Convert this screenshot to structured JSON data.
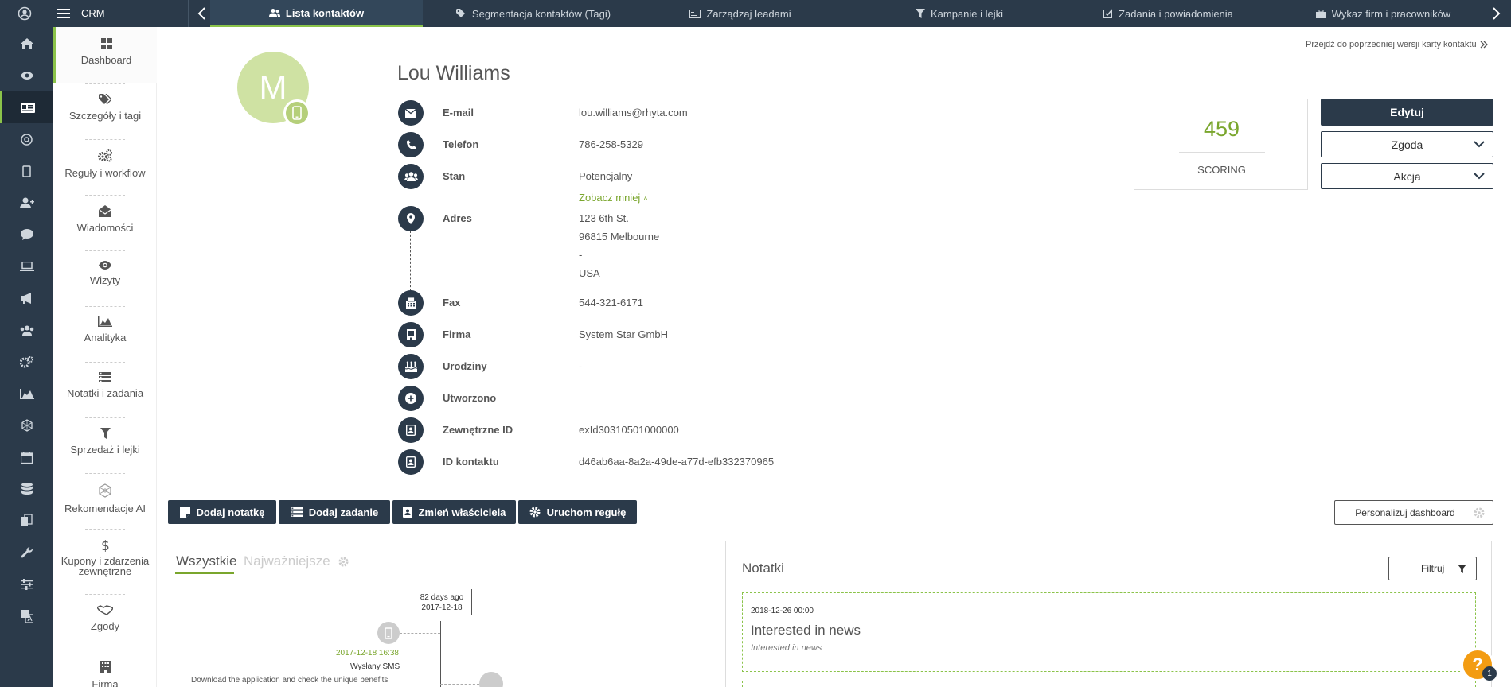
{
  "app": {
    "title": "CRM"
  },
  "nav_tabs": [
    {
      "label": "Lista kontaktów",
      "icon": "users-icon"
    },
    {
      "label": "Segmentacja kontaktów (Tagi)",
      "icon": "tags-icon"
    },
    {
      "label": "Zarządzaj leadami",
      "icon": "id-card-icon"
    },
    {
      "label": "Kampanie i lejki",
      "icon": "funnel-icon"
    },
    {
      "label": "Zadania i powiadomienia",
      "icon": "checkbox-icon"
    },
    {
      "label": "Wykaz firm i pracowników",
      "icon": "briefcase-icon"
    }
  ],
  "subnav": [
    {
      "label": "Dashboard",
      "icon": "dashboard-icon"
    },
    {
      "label": "Szczegóły i tagi",
      "icon": "tags-icon"
    },
    {
      "label": "Reguły i workflow",
      "icon": "cogs-icon"
    },
    {
      "label": "Wiadomości",
      "icon": "envelope-open-icon"
    },
    {
      "label": "Wizyty",
      "icon": "eye-icon"
    },
    {
      "label": "Analityka",
      "icon": "area-chart-icon"
    },
    {
      "label": "Notatki i zadania",
      "icon": "tasks-icon"
    },
    {
      "label": "Sprzedaż i lejki",
      "icon": "funnel-icon"
    },
    {
      "label": "Rekomendacje AI",
      "icon": "ai-icon"
    },
    {
      "label": "Kupony i zdarzenia",
      "label2": "zewnętrzne",
      "icon": "dollar-icon"
    },
    {
      "label": "Zgody",
      "icon": "handshake-icon"
    },
    {
      "label": "Firma",
      "icon": "building-icon"
    }
  ],
  "prev_version_link": "Przejdź do poprzedniej wersji karty kontaktu",
  "contact": {
    "avatar_letter": "M",
    "name": "Lou Williams",
    "fields": [
      {
        "label": "E-mail",
        "value": "lou.williams@rhyta.com",
        "icon": "envelope-icon"
      },
      {
        "label": "Telefon",
        "value": "786-258-5329",
        "icon": "phone-icon"
      },
      {
        "label": "Stan",
        "value": "Potencjalny",
        "icon": "group-icon"
      },
      {
        "label": "Adres",
        "icon": "map-marker-icon",
        "lines": [
          "123 6th St.",
          "96815 Melbourne",
          "-",
          "USA"
        ]
      },
      {
        "label": "Fax",
        "value": "544-321-6171",
        "icon": "fax-icon"
      },
      {
        "label": "Firma",
        "value": "System Star GmbH",
        "icon": "building-icon"
      },
      {
        "label": "Urodziny",
        "value": "-",
        "icon": "birthday-cake-icon"
      },
      {
        "label": "Utworzono",
        "value": "",
        "icon": "plus-circle-icon"
      },
      {
        "label": "Zewnętrzne ID",
        "value": "exId30310501000000",
        "icon": "contact-card-icon"
      },
      {
        "label": "ID kontaktu",
        "value": "d46ab6aa-8a2a-49de-a77d-efb332370965",
        "icon": "contact-card-icon"
      }
    ],
    "see_less": "Zobacz mniej"
  },
  "scoring": {
    "value": "459",
    "label": "SCORING"
  },
  "actions": {
    "edit": "Edytuj",
    "consent": "Zgoda",
    "action": "Akcja"
  },
  "toolbar": {
    "add_note": "Dodaj notatkę",
    "add_task": "Dodaj zadanie",
    "change_owner": "Zmień właściciela",
    "run_rule": "Uruchom regułę",
    "personalize": "Personalizuj dashboard"
  },
  "activity": {
    "tab_all": "Wszystkie",
    "tab_important": "Najważniejsze",
    "date_ago": "82 days ago",
    "date": "2017-12-18",
    "event_time": "2017-12-18 16:38",
    "event_title": "Wysłany SMS",
    "event_desc": "Download the application and check the unique benefits"
  },
  "notes": {
    "title": "Notatki",
    "filter": "Filtruj",
    "items": [
      {
        "date": "2018-12-26 00:00",
        "title": "Interested in news",
        "body": "Interested in news"
      }
    ]
  },
  "help": {
    "badge": "1"
  },
  "colors": {
    "dark": "#2b3a4a",
    "accent": "#8bc34a",
    "score": "#7aa62d",
    "avatar": "#cfe2a3"
  }
}
